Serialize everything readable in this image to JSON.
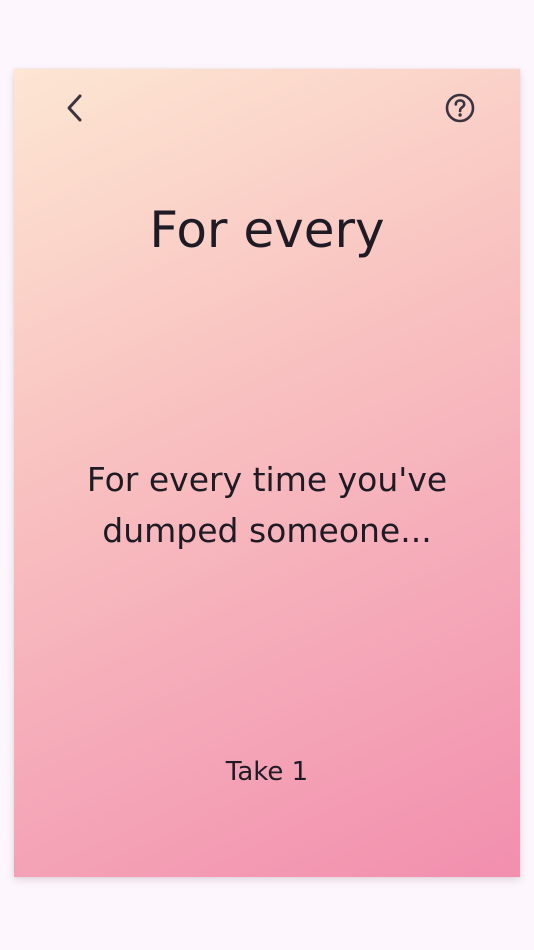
{
  "card": {
    "title": "For every",
    "prompt": "For every time you've dumped someone...",
    "action": "Take 1"
  },
  "toolbar": {
    "back_icon": "chevron-left-icon",
    "help_icon": "question-circle-icon"
  },
  "colors": {
    "background": "#fdf7fd",
    "gradient_start": "#fde6d3",
    "gradient_end": "#f28fae",
    "text": "#1f1b24",
    "icon": "#3b3440"
  }
}
